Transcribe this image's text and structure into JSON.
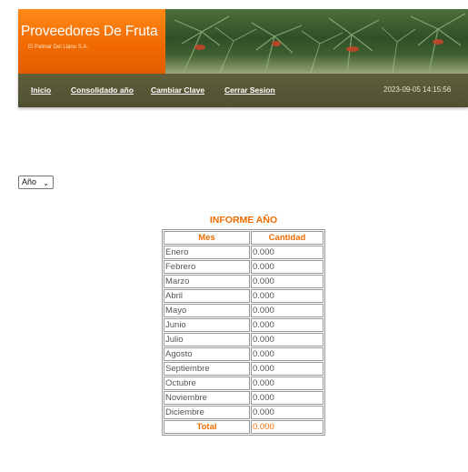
{
  "header": {
    "brand_title": "Proveedores De Fruta",
    "brand_subtitle": "El Palmar Del Llano S.A.",
    "banner_image": "palm-plantation-banner"
  },
  "nav": {
    "items": [
      "Inicio",
      "Consolidado año",
      "Cambiar Clave",
      "Cerrar Sesion"
    ],
    "datetime": "2023-09-05 14:15:56"
  },
  "filter": {
    "selected": "Año"
  },
  "report": {
    "title": "INFORME AÑO",
    "columns": [
      "Mes",
      "Cantidad"
    ],
    "rows": [
      [
        "Enero",
        "0.000"
      ],
      [
        "Febrero",
        "0.000"
      ],
      [
        "Marzo",
        "0.000"
      ],
      [
        "Abril",
        "0.000"
      ],
      [
        "Mayo",
        "0.000"
      ],
      [
        "Junio",
        "0.000"
      ],
      [
        "Julio",
        "0.000"
      ],
      [
        "Agosto",
        "0.000"
      ],
      [
        "Septiembre",
        "0.000"
      ],
      [
        "Octubre",
        "0.000"
      ],
      [
        "Noviembre",
        "0.000"
      ],
      [
        "Diciembre",
        "0.000"
      ]
    ],
    "total_label": "Total",
    "total_value": "0.000"
  },
  "colors": {
    "brand_orange": "#f26a00",
    "nav_olive": "#565838",
    "accent_text": "#f06c00"
  }
}
